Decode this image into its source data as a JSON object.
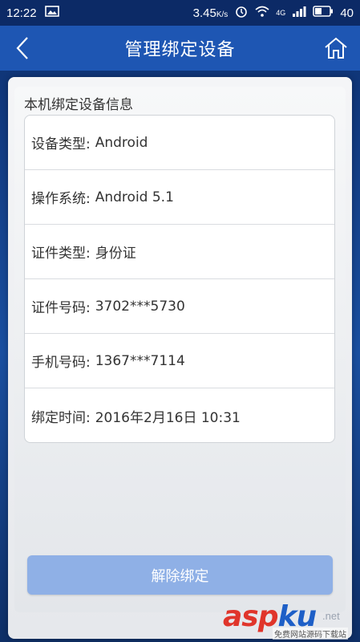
{
  "status_bar": {
    "time": "12:22",
    "speed": "3.45",
    "speed_unit": "K/s",
    "network": "4G",
    "battery": "40"
  },
  "header": {
    "title": "管理绑定设备",
    "back_icon": "chevron-left-icon",
    "home_icon": "home-icon"
  },
  "section": {
    "title": "本机绑定设备信息"
  },
  "info_rows": [
    {
      "label": "设备类型:",
      "value": "Android"
    },
    {
      "label": "操作系统:",
      "value": "Android 5.1"
    },
    {
      "label": "证件类型:",
      "value": "身份证"
    },
    {
      "label": "证件号码:",
      "value": "3702***5730"
    },
    {
      "label": "手机号码:",
      "value": "1367***7114"
    },
    {
      "label": "绑定时间:",
      "value": "2016年2月16日  10:31"
    }
  ],
  "actions": {
    "unbind_label": "解除绑定"
  },
  "watermark": {
    "part1": "asp",
    "part2": "ku",
    "suffix": ".net",
    "subtitle": "免费网站源码下载站"
  },
  "colors": {
    "header_bg": "#1e56b3",
    "button_bg": "#8fb0e6"
  }
}
